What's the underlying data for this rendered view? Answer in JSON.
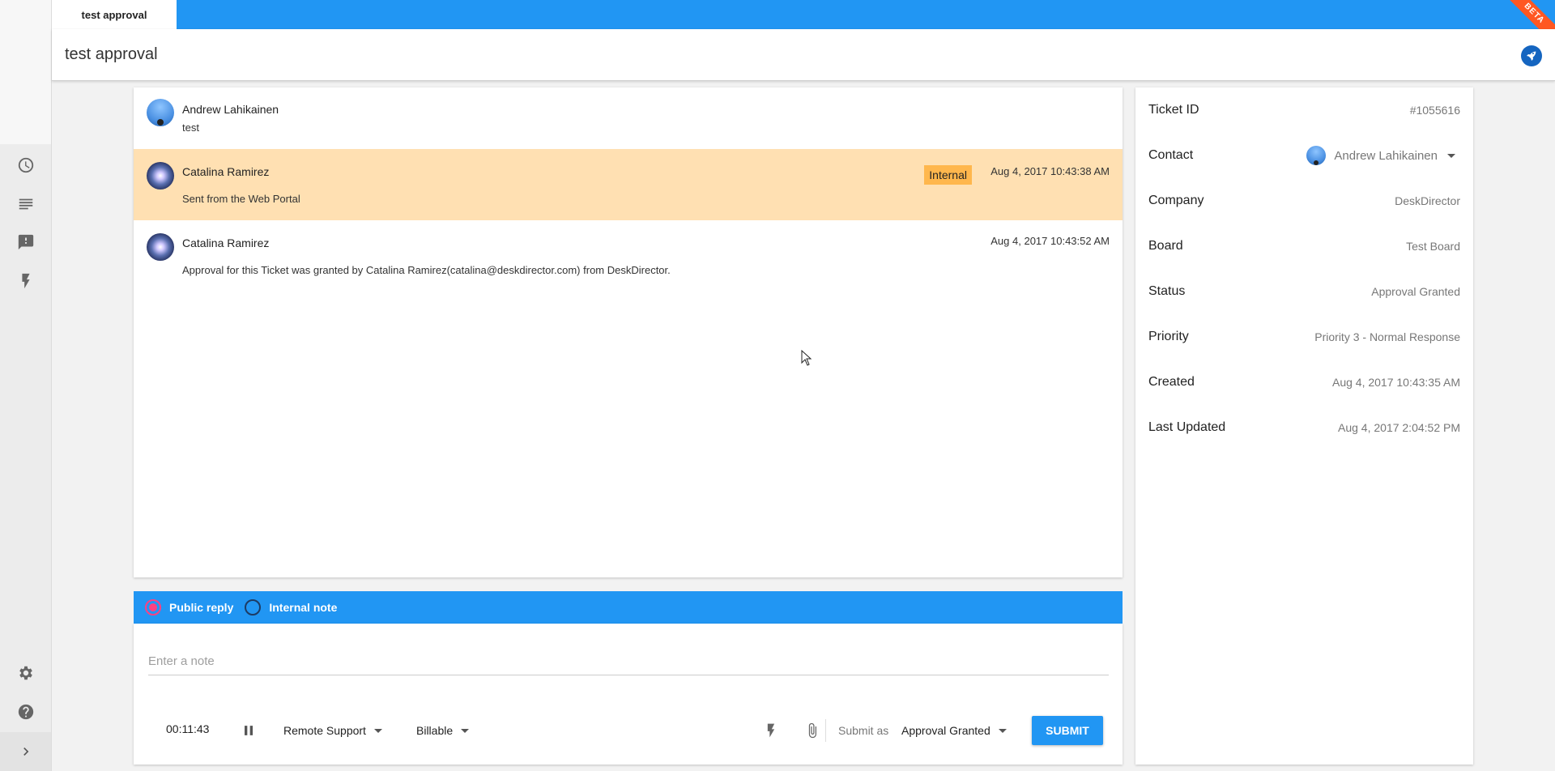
{
  "app": {
    "tab_label": "test approval",
    "beta_label": "BETA",
    "page_title": "test approval"
  },
  "nav": {
    "icons": [
      "clock-icon",
      "list-icon",
      "feedback-icon",
      "flash-icon",
      "gear-icon",
      "help-icon",
      "chevron-right-icon"
    ]
  },
  "messages": [
    {
      "sender": "Andrew Lahikainen",
      "body": "test",
      "timestamp": "",
      "badge": ""
    },
    {
      "sender": "Catalina Ramirez",
      "body": "Sent from the Web Portal",
      "timestamp": "Aug 4, 2017 10:43:38 AM",
      "badge": "Internal"
    },
    {
      "sender": "Catalina Ramirez",
      "body": "Approval for this Ticket was granted by Catalina Ramirez(catalina@deskdirector.com) from DeskDirector.",
      "timestamp": "Aug 4, 2017 10:43:52 AM",
      "badge": ""
    }
  ],
  "reply": {
    "public_label": "Public reply",
    "internal_label": "Internal note",
    "note_placeholder": "Enter a note",
    "timer": "00:11:43",
    "work_type": "Remote Support",
    "billing": "Billable",
    "submit_as_label": "Submit as",
    "submit_status": "Approval Granted",
    "submit_label": "SUBMIT"
  },
  "details": {
    "rows": [
      {
        "label": "Ticket ID",
        "value": "#1055616"
      },
      {
        "label": "Contact",
        "value": "Andrew Lahikainen"
      },
      {
        "label": "Company",
        "value": "DeskDirector"
      },
      {
        "label": "Board",
        "value": "Test Board"
      },
      {
        "label": "Status",
        "value": "Approval Granted"
      },
      {
        "label": "Priority",
        "value": "Priority 3 - Normal Response"
      },
      {
        "label": "Created",
        "value": "Aug 4, 2017 10:43:35 AM"
      },
      {
        "label": "Last Updated",
        "value": "Aug 4, 2017 2:04:52 PM"
      }
    ]
  },
  "colors": {
    "primary": "#2196f3",
    "internal_bg": "#ffe0b2",
    "internal_badge": "#ffb74d",
    "accent": "#ff4081",
    "beta": "#ff5722"
  }
}
